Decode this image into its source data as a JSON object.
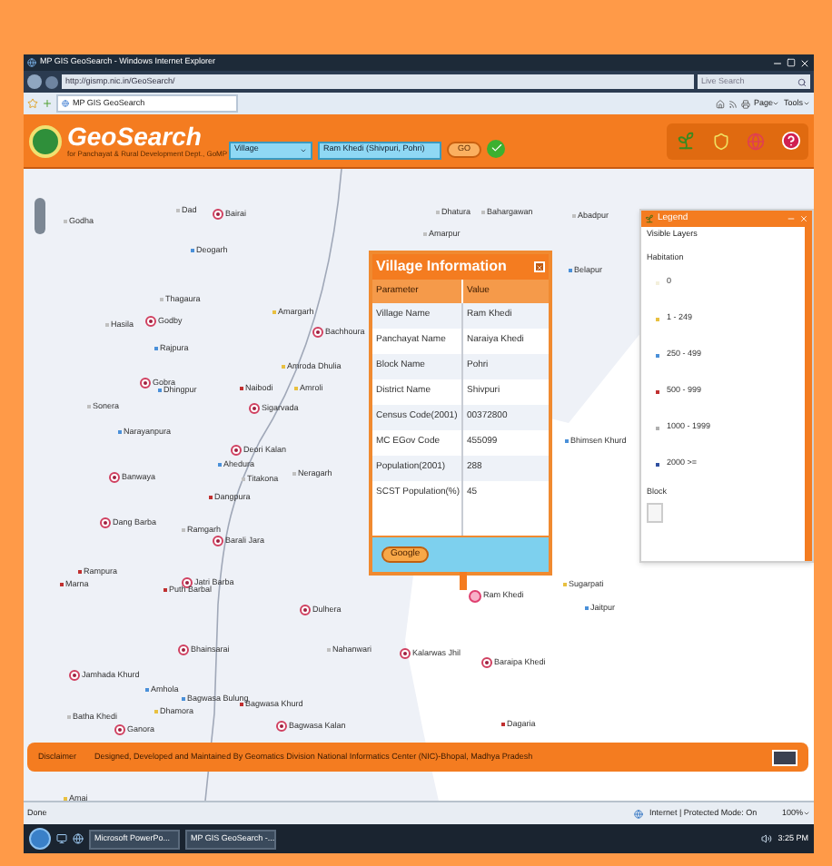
{
  "window": {
    "title": "MP GIS GeoSearch - Windows Internet Explorer"
  },
  "address_bar": {
    "url": "http://gismp.nic.in/GeoSearch/",
    "search_placeholder": "Live Search"
  },
  "tab_bar": {
    "tab": "MP GIS GeoSearch",
    "commands": [
      "Page",
      "Tools"
    ]
  },
  "app_header": {
    "title": "GeoSearch",
    "subtitle": "for Panchayat & Rural Development Dept., GoMP",
    "layer_select": "Village",
    "search_value": "Ram Khedi (Shivpuri, Pohri)",
    "go_button": "GO"
  },
  "map": {
    "places": [
      {
        "name": "Godha",
        "kind": "dot",
        "color": "#c0c0c0"
      },
      {
        "name": "Dad",
        "kind": "dot",
        "color": "#c0c0c0"
      },
      {
        "name": "Bairai",
        "kind": "circle"
      },
      {
        "name": "Deogarh",
        "kind": "dot",
        "color": "#4a90d9"
      },
      {
        "name": "Thagaura",
        "kind": "dot",
        "color": "#c0c0c0"
      },
      {
        "name": "Godby",
        "kind": "circle"
      },
      {
        "name": "Hasila",
        "kind": "dot",
        "color": "#c0c0c0"
      },
      {
        "name": "Amargarh",
        "kind": "dot",
        "color": "#e8c040"
      },
      {
        "name": "Bachhoura",
        "kind": "circle"
      },
      {
        "name": "Rajpura",
        "kind": "dot",
        "color": "#4a90d9"
      },
      {
        "name": "Amroda Dhulia",
        "kind": "dot",
        "color": "#e8c040"
      },
      {
        "name": "Gobra",
        "kind": "circle"
      },
      {
        "name": "Dhingpur",
        "kind": "dot",
        "color": "#4a90d9"
      },
      {
        "name": "Naibodi",
        "kind": "dot",
        "color": "#c03030"
      },
      {
        "name": "Amroli",
        "kind": "dot",
        "color": "#e8c040"
      },
      {
        "name": "Sonera",
        "kind": "dot",
        "color": "#c0c0c0"
      },
      {
        "name": "Sigarvada",
        "kind": "circle"
      },
      {
        "name": "Narayanpura",
        "kind": "dot",
        "color": "#4a90d9"
      },
      {
        "name": "Deori Kalan",
        "kind": "circle"
      },
      {
        "name": "Ahedura",
        "kind": "dot",
        "color": "#4a90d9"
      },
      {
        "name": "Titakona",
        "kind": "dot",
        "color": "#c0c0c0"
      },
      {
        "name": "Neragarh",
        "kind": "dot",
        "color": "#c0c0c0"
      },
      {
        "name": "Banwaya",
        "kind": "circle"
      },
      {
        "name": "Dangpura",
        "kind": "dot",
        "color": "#c03030"
      },
      {
        "name": "Dang Barba",
        "kind": "circle"
      },
      {
        "name": "Ramgarh",
        "kind": "dot",
        "color": "#c0c0c0"
      },
      {
        "name": "Barali Jara",
        "kind": "circle"
      },
      {
        "name": "Rampura",
        "kind": "dot",
        "color": "#c03030"
      },
      {
        "name": "Marna",
        "kind": "dot",
        "color": "#c03030"
      },
      {
        "name": "Jatri Barba",
        "kind": "circle"
      },
      {
        "name": "Puth Barbal",
        "kind": "dot",
        "color": "#c03030"
      },
      {
        "name": "Dulhera",
        "kind": "circle"
      },
      {
        "name": "Bhainsarai",
        "kind": "circle"
      },
      {
        "name": "Nahanwari",
        "kind": "dot",
        "color": "#c0c0c0"
      },
      {
        "name": "Jamhada Khurd",
        "kind": "circle"
      },
      {
        "name": "Amhola",
        "kind": "dot",
        "color": "#4a90d9"
      },
      {
        "name": "Bagwasa Bulung",
        "kind": "dot",
        "color": "#4a90d9"
      },
      {
        "name": "Bagwasa Khurd",
        "kind": "dot",
        "color": "#c03030"
      },
      {
        "name": "Bagwasa Kalan",
        "kind": "circle"
      },
      {
        "name": "Batha Khedi",
        "kind": "dot",
        "color": "#c0c0c0"
      },
      {
        "name": "Dhamora",
        "kind": "dot",
        "color": "#e8c040"
      },
      {
        "name": "Ganora",
        "kind": "circle"
      },
      {
        "name": "Dhatura",
        "kind": "dot",
        "color": "#c0c0c0"
      },
      {
        "name": "Bahargawan",
        "kind": "dot",
        "color": "#c0c0c0"
      },
      {
        "name": "Amarpur",
        "kind": "dot",
        "color": "#c0c0c0"
      },
      {
        "name": "Abadpur",
        "kind": "dot",
        "color": "#c0c0c0"
      },
      {
        "name": "Belapur",
        "kind": "dot",
        "color": "#4a90d9"
      },
      {
        "name": "Bhimsen Khurd",
        "kind": "dot",
        "color": "#4a90d9"
      },
      {
        "name": "Ram Khedi",
        "kind": "selected"
      },
      {
        "name": "Sugarpati",
        "kind": "dot",
        "color": "#e8c040"
      },
      {
        "name": "Jaitpur",
        "kind": "dot",
        "color": "#4a90d9"
      },
      {
        "name": "Kalarwas Jhil",
        "kind": "circle"
      },
      {
        "name": "Baraipa Khedi",
        "kind": "circle"
      },
      {
        "name": "Dagaria",
        "kind": "dot",
        "color": "#c03030"
      },
      {
        "name": "Amai",
        "kind": "dot",
        "color": "#e8c040"
      }
    ]
  },
  "popup": {
    "title": "Village Information",
    "columns": [
      "Parameter",
      "Value"
    ],
    "rows": [
      [
        "Village Name",
        "Ram Khedi"
      ],
      [
        "Panchayat Name",
        "Naraiya Khedi"
      ],
      [
        "Block Name",
        "Pohri"
      ],
      [
        "District Name",
        "Shivpuri"
      ],
      [
        "Census Code(2001)",
        "00372800"
      ],
      [
        "MC EGov Code",
        "455099"
      ],
      [
        "Population(2001)",
        "288"
      ],
      [
        "SCST Population(%)",
        "45"
      ]
    ],
    "button": "Google"
  },
  "legend": {
    "title": "Legend",
    "subtitle": "Visible Layers",
    "group": "Habitation",
    "items": [
      {
        "label": "0",
        "color": "#f4f0dc"
      },
      {
        "label": "1 - 249",
        "color": "#e8c040"
      },
      {
        "label": "250 - 499",
        "color": "#4a90d9"
      },
      {
        "label": "500 - 999",
        "color": "#c03030"
      },
      {
        "label": "1000 - 1999",
        "color": "#b0b0b0"
      },
      {
        "label": "2000 >=",
        "color": "#3050a0"
      }
    ],
    "group_2": "Block"
  },
  "footer": {
    "label": "Disclaimer",
    "text": "Designed, Developed and Maintained By Geomatics Division National Informatics Center (NIC)-Bhopal, Madhya Pradesh"
  },
  "status_bar": {
    "status": "Done",
    "zone": "Internet | Protected Mode: On",
    "zoom": "100%"
  },
  "taskbar": {
    "buttons": [
      "Microsoft PowerPo...",
      "MP GIS GeoSearch -..."
    ],
    "time": "3:25 PM"
  }
}
